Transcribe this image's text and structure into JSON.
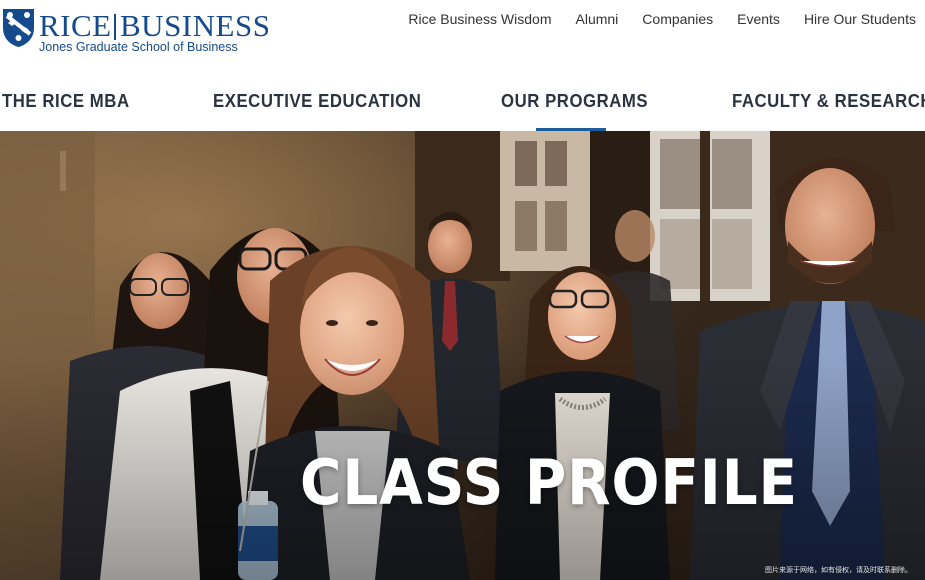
{
  "colors": {
    "brand_blue": "#154b8c",
    "nav_text": "#2b3340",
    "underline": "#1d5c9a",
    "hero_title": "#ffffff"
  },
  "logo": {
    "rice": "RICE",
    "business": "BUSINESS",
    "subtitle": "Jones Graduate School of Business",
    "icon": "owl-shield-icon"
  },
  "utility_nav": [
    {
      "label": "Rice Business Wisdom"
    },
    {
      "label": "Alumni"
    },
    {
      "label": "Companies"
    },
    {
      "label": "Events"
    },
    {
      "label": "Hire Our Students"
    }
  ],
  "main_nav": [
    {
      "label": "THE RICE MBA",
      "active": false
    },
    {
      "label": "EXECUTIVE EDUCATION",
      "active": false
    },
    {
      "label": "OUR PROGRAMS",
      "active": true
    },
    {
      "label": "FACULTY & RESEARCH",
      "active": false
    }
  ],
  "hero": {
    "title": "CLASS PROFILE",
    "watermark": "图片来源于网络，如有侵权，请及时联系删除。"
  }
}
